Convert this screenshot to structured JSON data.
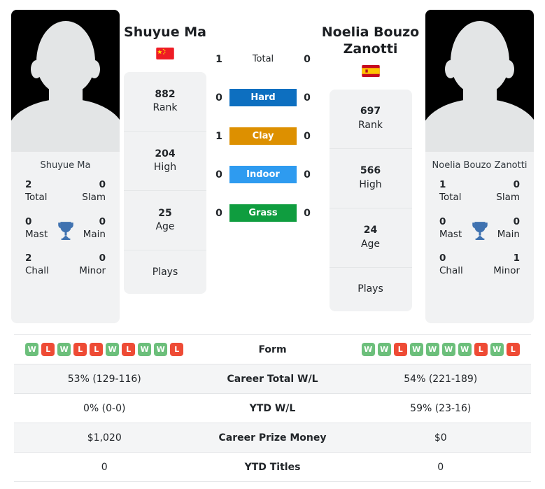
{
  "players": {
    "left": {
      "name": "Shuyue Ma",
      "photo_caption": "Shuyue Ma",
      "flag": "cn-flag-icon",
      "rank": "882",
      "rank_label": "Rank",
      "high": "204",
      "high_label": "High",
      "age": "25",
      "age_label": "Age",
      "plays_label": "Plays",
      "plays_value": "",
      "titles": {
        "total": "2",
        "total_label": "Total",
        "slam": "0",
        "slam_label": "Slam",
        "mast": "0",
        "mast_label": "Mast",
        "main": "0",
        "main_label": "Main",
        "chall": "2",
        "chall_label": "Chall",
        "minor": "0",
        "minor_label": "Minor"
      }
    },
    "right": {
      "name": "Noelia Bouzo Zanotti",
      "photo_caption": "Noelia Bouzo Zanotti",
      "flag": "es-flag-icon",
      "rank": "697",
      "rank_label": "Rank",
      "high": "566",
      "high_label": "High",
      "age": "24",
      "age_label": "Age",
      "plays_label": "Plays",
      "plays_value": "",
      "titles": {
        "total": "1",
        "total_label": "Total",
        "slam": "0",
        "slam_label": "Slam",
        "mast": "0",
        "mast_label": "Mast",
        "main": "0",
        "main_label": "Main",
        "chall": "0",
        "chall_label": "Chall",
        "minor": "1",
        "minor_label": "Minor"
      }
    }
  },
  "head_to_head": [
    {
      "label": "Total",
      "left": "1",
      "right": "0",
      "color": "",
      "plain": true
    },
    {
      "label": "Hard",
      "left": "0",
      "right": "0",
      "color": "#0d6fc0",
      "plain": false
    },
    {
      "label": "Clay",
      "left": "1",
      "right": "0",
      "color": "#dd9000",
      "plain": false
    },
    {
      "label": "Indoor",
      "left": "0",
      "right": "0",
      "color": "#2e9bf0",
      "plain": false
    },
    {
      "label": "Grass",
      "left": "0",
      "right": "0",
      "color": "#0f9d3f",
      "plain": false
    }
  ],
  "stats": {
    "form": {
      "label": "Form",
      "left": [
        "W",
        "L",
        "W",
        "L",
        "L",
        "W",
        "L",
        "W",
        "W",
        "L"
      ],
      "right": [
        "W",
        "W",
        "L",
        "W",
        "W",
        "W",
        "W",
        "L",
        "W",
        "L"
      ]
    },
    "rows": [
      {
        "label": "Career Total W/L",
        "left": "53% (129-116)",
        "right": "54% (221-189)"
      },
      {
        "label": "YTD W/L",
        "left": "0% (0-0)",
        "right": "59% (23-16)"
      },
      {
        "label": "Career Prize Money",
        "left": "$1,020",
        "right": "$0"
      },
      {
        "label": "YTD Titles",
        "left": "0",
        "right": "0"
      }
    ]
  },
  "colors": {
    "win": "#6cbf7b",
    "loss": "#ee4b35",
    "trophy": "#3f72b0",
    "card_bg": "#f1f2f3",
    "row_shade": "#f4f5f6"
  }
}
